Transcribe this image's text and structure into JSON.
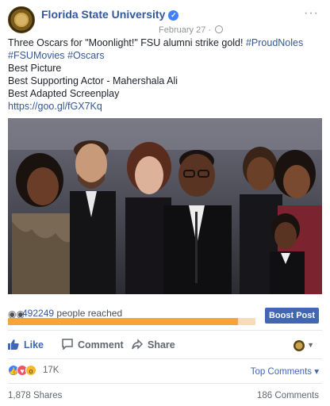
{
  "header": {
    "page_name": "Florida State University",
    "date": "February 27 ·",
    "options_icon": "ellipsis-icon"
  },
  "post": {
    "lines": [
      "Three Oscars for \"Moonlight!\" FSU alumni strike gold!",
      "#ProudNoles",
      "#FSUMovies",
      "#Oscars",
      "Best Picture",
      "Best Supporting Actor - Mahershala Ali",
      "Best Adapted Screenplay",
      "https://goo.gl/fGX7Kq"
    ]
  },
  "reach": {
    "count": "492249",
    "label": "people reached",
    "progress_percent": 93,
    "boost_label": "Boost Post"
  },
  "actions": {
    "like": "Like",
    "comment": "Comment",
    "share": "Share"
  },
  "engagement": {
    "reaction_count": "17K",
    "top_comments": "Top Comments ▾",
    "shares": "1,878 Shares",
    "comments": "186 Comments"
  },
  "colors": {
    "link": "#365899",
    "boost": "#4267b2",
    "progress_fill": "#f5a33f",
    "progress_track": "#f6dcb8"
  }
}
